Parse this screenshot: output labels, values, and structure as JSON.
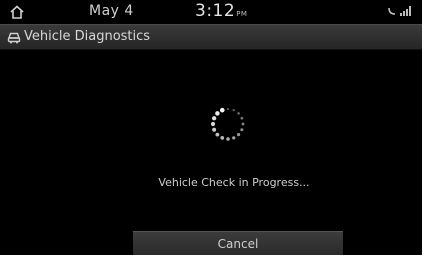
{
  "status_bar": {
    "date": "May 4",
    "time": "3:12",
    "time_suffix": "PM"
  },
  "title_bar": {
    "title": "Vehicle Diagnostics"
  },
  "main": {
    "progress_text": "Vehicle Check in Progress..."
  },
  "buttons": {
    "cancel_label": "Cancel"
  },
  "icons": {
    "home": "home-icon",
    "diagnostics": "car-diagnostics-icon",
    "spinner": "loading-spinner-icon",
    "phone": "phone-status-icon",
    "signal": "signal-icon"
  }
}
